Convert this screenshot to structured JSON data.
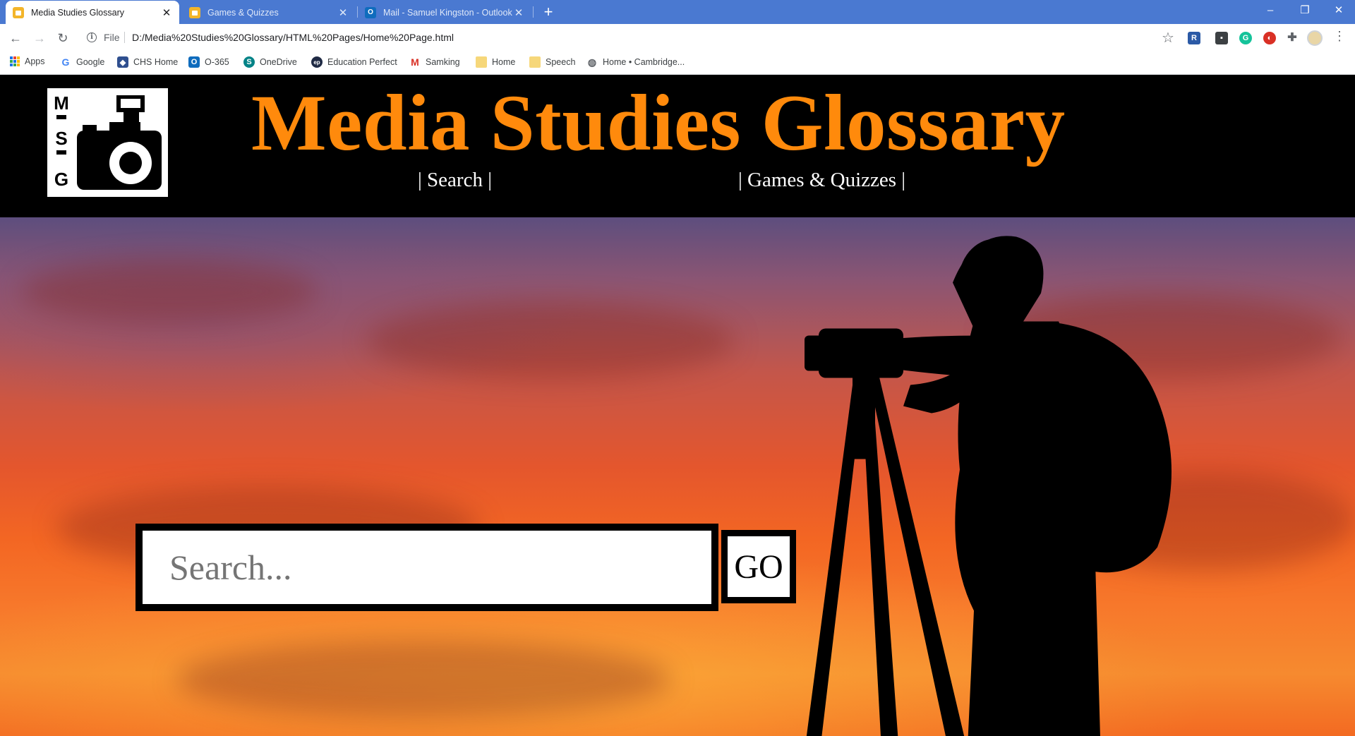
{
  "browser": {
    "tabs": [
      {
        "title": "Media Studies Glossary",
        "active": true
      },
      {
        "title": "Games & Quizzes",
        "active": false
      },
      {
        "title": "Mail - Samuel Kingston - Outlook",
        "active": false
      }
    ],
    "new_tab_label": "+",
    "window_controls": {
      "minimize": "–",
      "restore": "❐",
      "close": "✕"
    },
    "nav": {
      "back": "←",
      "forward": "→",
      "reload": "↻"
    },
    "address": {
      "scheme": "File",
      "url": "D:/Media%20Studies%20Glossary/HTML%20Pages/Home%20Page.html"
    },
    "bookmarks": [
      {
        "label": "Apps",
        "icon": "apps-grid-icon"
      },
      {
        "label": "Google",
        "icon": "google-icon"
      },
      {
        "label": "CHS Home",
        "icon": "chs-icon"
      },
      {
        "label": "O-365",
        "icon": "outlook-icon"
      },
      {
        "label": "OneDrive",
        "icon": "sharepoint-icon"
      },
      {
        "label": "Education Perfect",
        "icon": "ep-icon"
      },
      {
        "label": "Samking",
        "icon": "gmail-icon"
      },
      {
        "label": "Home",
        "icon": "folder-icon"
      },
      {
        "label": "Speech",
        "icon": "folder-icon"
      },
      {
        "label": "Home • Cambridge...",
        "icon": "globe-icon"
      }
    ]
  },
  "site": {
    "title": "Media Studies Glossary",
    "logo_letters": [
      "M",
      "S",
      "G"
    ],
    "nav": {
      "search": "| Search |",
      "games": "| Games & Quizzes |"
    }
  },
  "search": {
    "placeholder": "Search...",
    "value": "",
    "go_label": "GO"
  },
  "colors": {
    "title_orange": "#ff8a0c",
    "header_bg": "#000000",
    "tabbar_blue": "#4a79d1"
  }
}
